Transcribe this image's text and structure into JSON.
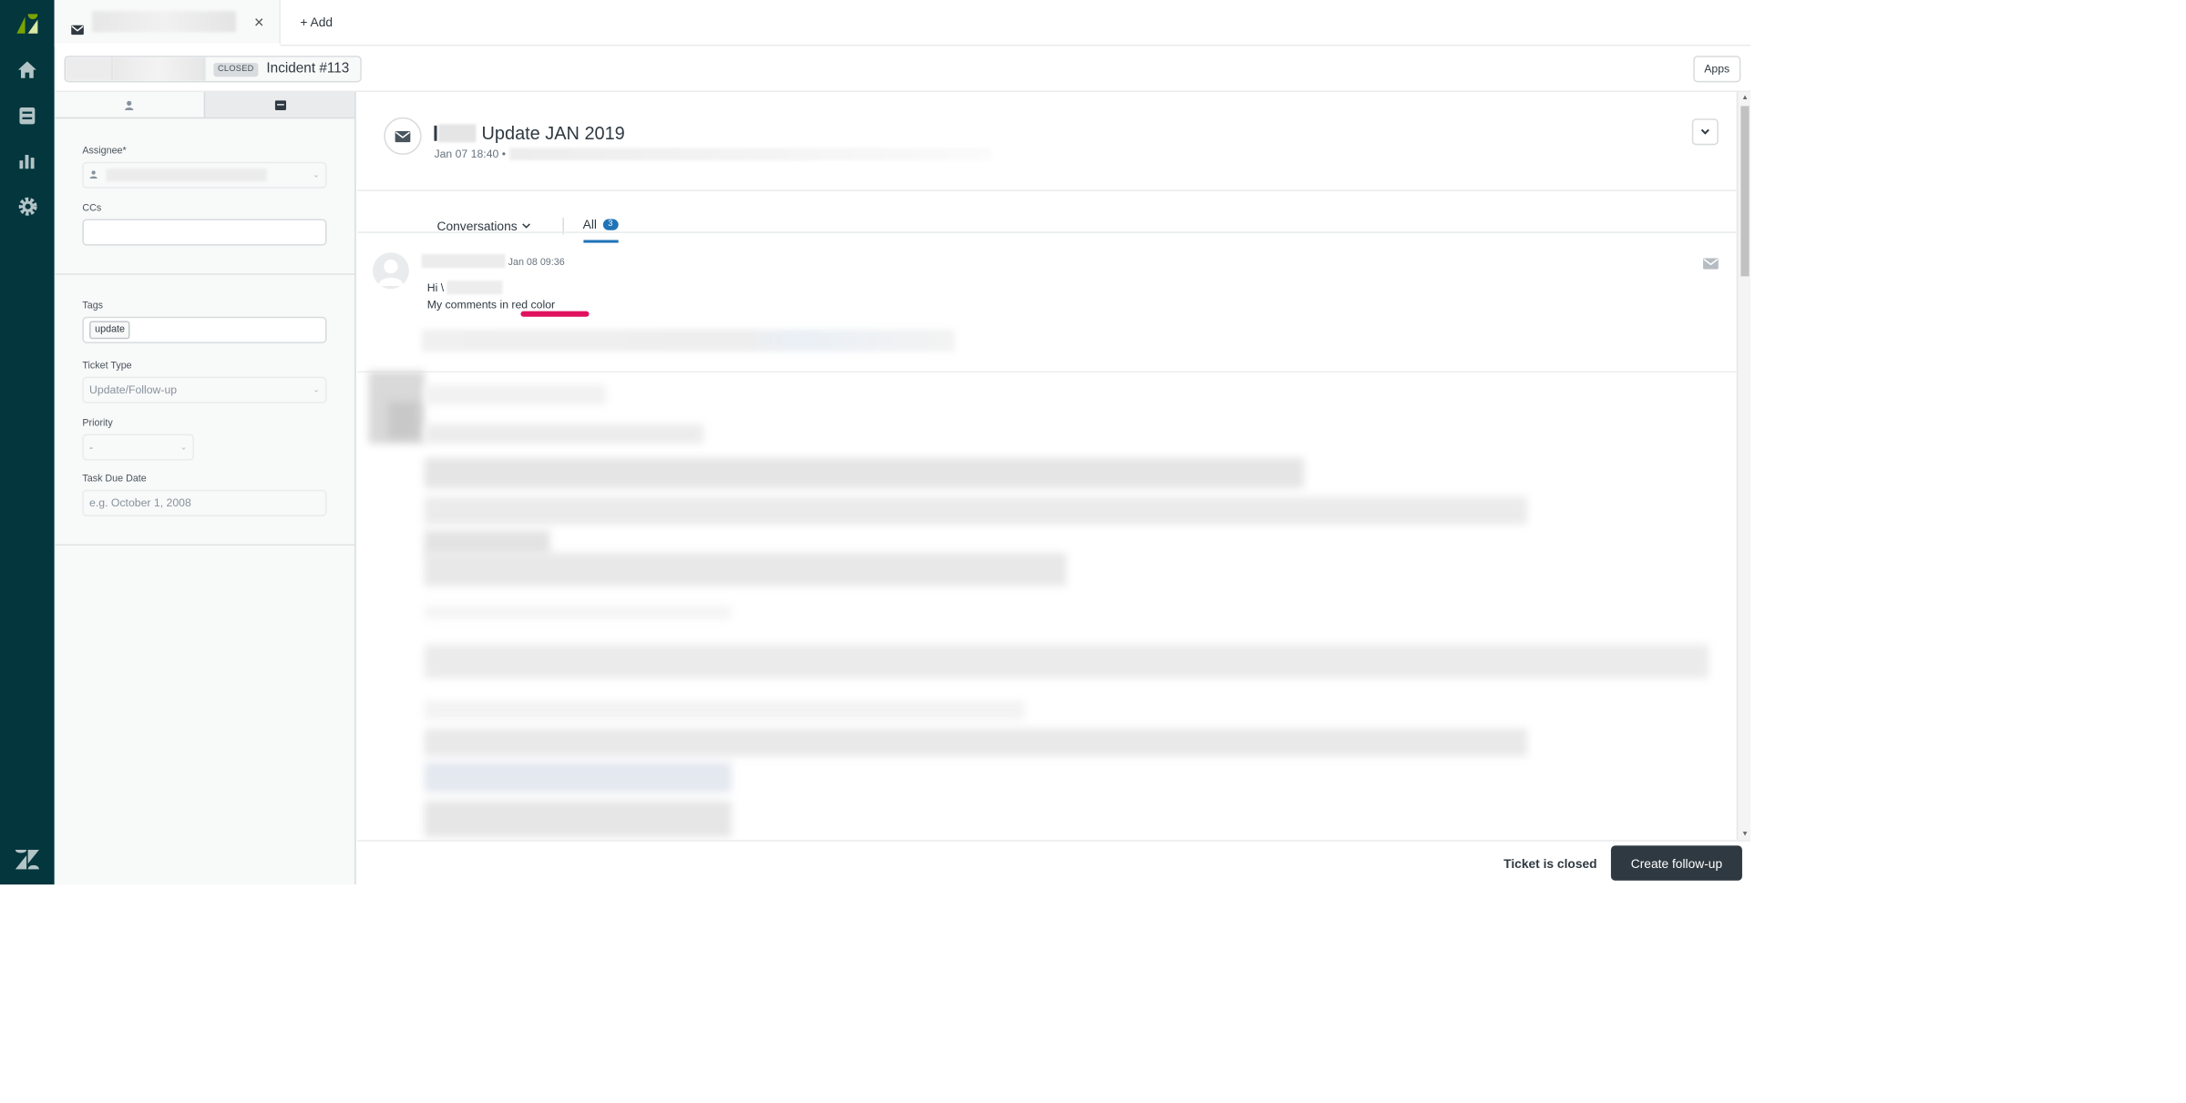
{
  "colors": {
    "nav_bg": "#03363d",
    "accent_blue": "#1f73b7",
    "annotation_red": "#e0115f",
    "phone_green": "#1f8a60",
    "dark_button": "#2f3941"
  },
  "topbar": {
    "tab_icon": "mail-icon",
    "tab_close": "×",
    "add_label": "+ Add"
  },
  "breadcrumb": {
    "status_badge": "CLOSED",
    "ticket_label": "Incident #113"
  },
  "apps_button": "Apps",
  "properties": {
    "tabs": [
      {
        "icon": "user-icon"
      },
      {
        "icon": "ticket-icon"
      }
    ],
    "assignee_label": "Assignee*",
    "ccs_label": "CCs",
    "tags_label": "Tags",
    "tag_value": "update",
    "ticket_type_label": "Ticket Type",
    "ticket_type_value": "Update/Follow-up",
    "priority_label": "Priority",
    "priority_value": "-",
    "due_date_label": "Task Due Date",
    "due_date_placeholder": "e.g. October 1, 2008"
  },
  "ticket": {
    "subject_visible": "Update JAN 2019",
    "created": "Jan 07 18:40 •"
  },
  "filters": {
    "conversations_label": "Conversations",
    "all_label": "All",
    "all_count": "3"
  },
  "comment": {
    "timestamp": "Jan 08 09:36",
    "greeting": "Hi \\",
    "body": "My comments in red color"
  },
  "footer": {
    "status": "Ticket is closed",
    "followup_button": "Create follow-up"
  }
}
